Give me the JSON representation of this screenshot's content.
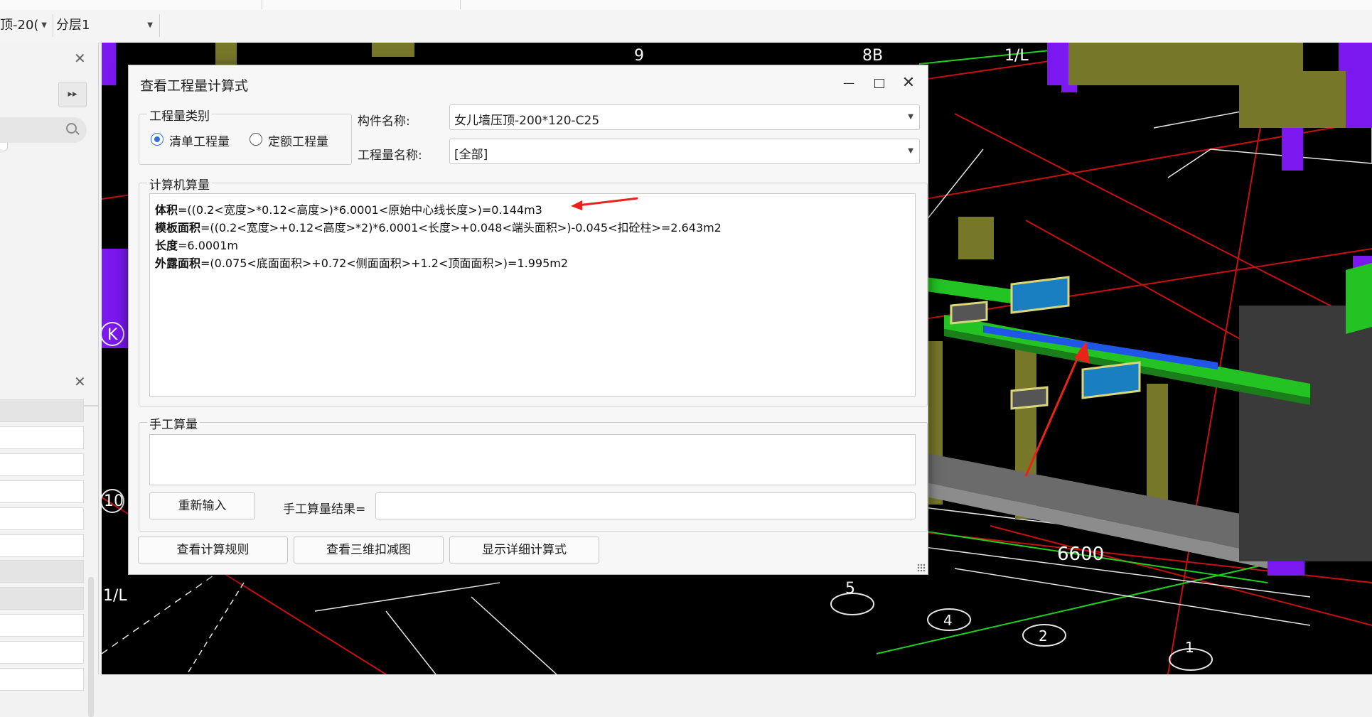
{
  "toolbar": {
    "layer_combo": "顶-20(",
    "floor_combo": "分层1"
  },
  "cad": {
    "axis_labels": [
      "9",
      "8B",
      "1/L",
      "K",
      "10",
      "1/L",
      "5",
      "4",
      "2",
      "1"
    ],
    "dimension_6600": "6600",
    "colors": {
      "background": "#000000",
      "purple": "#8a1fff",
      "green": "#22dd22",
      "olive": "#8a8a2a",
      "red_line": "#e01010",
      "arrow": "#e8231a"
    }
  },
  "dialog": {
    "title": "查看工程量计算式",
    "quantity_type_group": "工程量类别",
    "radio_bill": "清单工程量",
    "radio_quota": "定额工程量",
    "selected_radio": "清单工程量",
    "component_name_label": "构件名称:",
    "component_name_value": "女儿墙压顶-200*120-C25",
    "quantity_name_label": "工程量名称:",
    "quantity_name_value": "[全部]",
    "computer_calc_group": "计算机算量",
    "formulas": [
      {
        "label": "体积",
        "expr": "=((0.2<宽度>*0.12<高度>)*6.0001<原始中心线长度>)=0.144m3"
      },
      {
        "label": "模板面积",
        "expr": "=((0.2<宽度>+0.12<高度>*2)*6.0001<长度>+0.048<端头面积>)-0.045<扣砼柱>=2.643m2"
      },
      {
        "label": "长度",
        "expr": "=6.0001m"
      },
      {
        "label": "外露面积",
        "expr": "=(0.075<底面面积>+0.72<侧面面积>+1.2<顶面面积>)=1.995m2"
      }
    ],
    "manual_calc_group": "手工算量",
    "reenter_button": "重新输入",
    "manual_result_label": "手工算量结果=",
    "manual_result_value": "",
    "btn_view_rules": "查看计算规则",
    "btn_view_3d": "查看三维扣减图",
    "btn_show_detail": "显示详细计算式"
  }
}
